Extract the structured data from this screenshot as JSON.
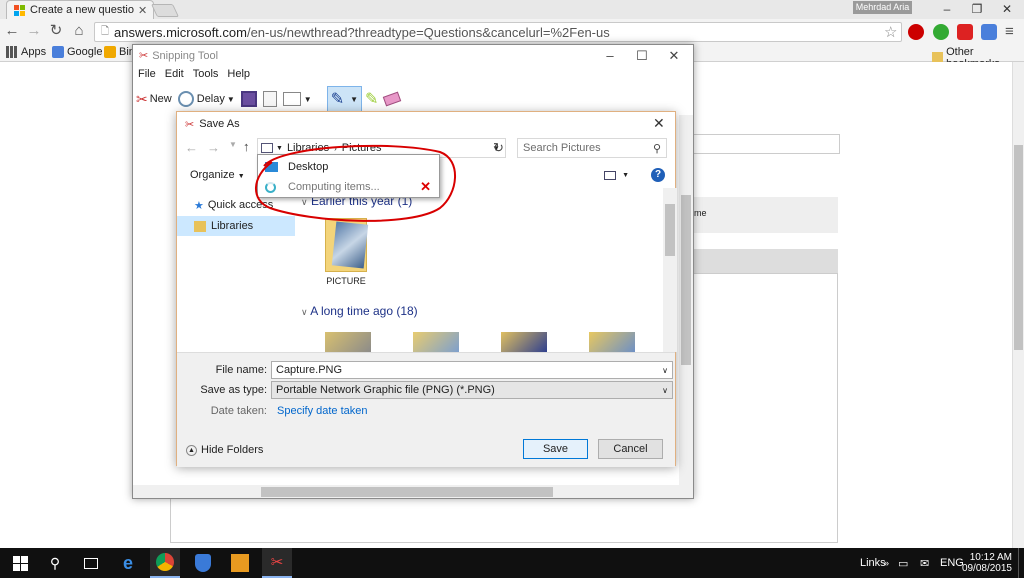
{
  "browser": {
    "tab_title": "Create a new question or",
    "url_host": "answers.microsoft.com",
    "url_path": "/en-us/newthread?threadtype=Questions&cancelurl=%2Fen-us",
    "user": "Mehrdad Aria",
    "bookmarks": [
      "Apps",
      "Google",
      "Bin"
    ],
    "other_bookmarks": "Other bookmarks"
  },
  "snipping_tool": {
    "title": "Snipping Tool",
    "menu": [
      "File",
      "Edit",
      "Tools",
      "Help"
    ],
    "new_label": "New",
    "delay_label": "Delay"
  },
  "save_as": {
    "title": "Save As",
    "breadcrumb": [
      "Libraries",
      "Pictures"
    ],
    "search_placeholder": "Search Pictures",
    "organize_label": "Organize",
    "nav_items": [
      "Quick access",
      "Libraries"
    ],
    "groups": [
      {
        "label": "Earlier this year (1)"
      },
      {
        "label": "A long time ago (18)"
      }
    ],
    "folder_label": "PICTURE",
    "file_name_label": "File name:",
    "file_name_value": "Capture.PNG",
    "save_type_label": "Save as type:",
    "save_type_value": "Portable Network Graphic file (PNG) (*.PNG)",
    "date_taken_label": "Date taken:",
    "date_taken_value": "Specify date taken",
    "hide_folders": "Hide Folders",
    "save_button": "Save",
    "cancel_button": "Cancel"
  },
  "dropdown": {
    "items": [
      "Desktop",
      "Computing items..."
    ]
  },
  "page": {
    "partial_text": "me"
  },
  "taskbar": {
    "links": "Links",
    "lang": "ENG",
    "time": "10:12 AM",
    "date": "09/08/2015"
  },
  "colors": {
    "accent": "#0078d7",
    "annotation": "#d80000",
    "link": "#0066cc"
  }
}
